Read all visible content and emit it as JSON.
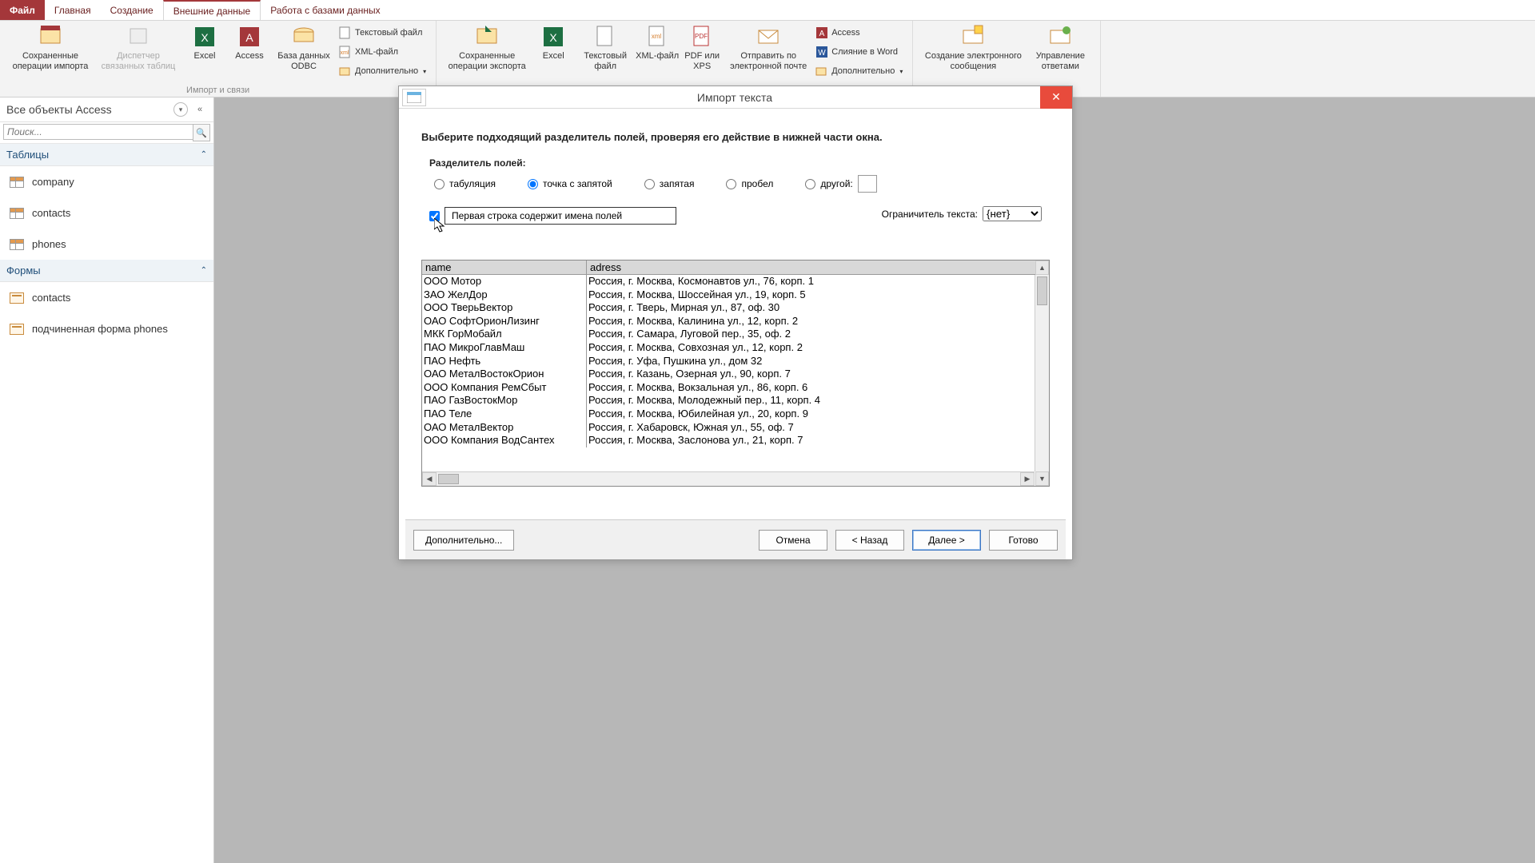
{
  "tabs": {
    "file": "Файл",
    "home": "Главная",
    "create": "Создание",
    "external": "Внешние данные",
    "db": "Работа с базами данных"
  },
  "ribbon": {
    "saved_import": "Сохраненные операции импорта",
    "linked_mgr": "Диспетчер связанных таблиц",
    "excel": "Excel",
    "access": "Access",
    "odbc": "База данных ODBC",
    "textfile": "Текстовый файл",
    "xmlfile": "XML-файл",
    "more": "Дополнительно",
    "group1": "Импорт и связи",
    "saved_export": "Сохраненные операции экспорта",
    "excel2": "Excel",
    "textfile2": "Текстовый файл",
    "xmlfile2": "XML-файл",
    "pdf": "PDF или XPS",
    "email": "Отправить по электронной почте",
    "access2": "Access",
    "word": "Слияние в Word",
    "more2": "Дополнительно",
    "emailmsg": "Создание электронного сообщения",
    "replies": "Управление ответами"
  },
  "nav": {
    "title": "Все объекты Access",
    "search_ph": "Поиск...",
    "group_tables": "Таблицы",
    "group_forms": "Формы",
    "tables": [
      "company",
      "contacts",
      "phones"
    ],
    "forms": [
      "contacts",
      "подчиненная форма phones"
    ]
  },
  "dialog": {
    "title": "Импорт текста",
    "instruction": "Выберите подходящий разделитель полей, проверяя его действие в нижней части окна.",
    "delimiter_label": "Разделитель полей:",
    "radios": {
      "tab": "табуляция",
      "semicolon": "точка с запятой",
      "comma": "запятая",
      "space": "пробел",
      "other": "другой:"
    },
    "selected": "semicolon",
    "firstrow_label": "Первая строка содержит имена полей",
    "firstrow_checked": true,
    "qualifier_label": "Ограничитель текста:",
    "qualifier_value": "{нет}",
    "columns": [
      "name",
      "adress"
    ],
    "rows": [
      [
        "ООО Мотор",
        "Россия, г. Москва, Космонавтов ул., 76, корп. 1"
      ],
      [
        "ЗАО ЖелДор",
        "Россия, г. Москва, Шоссейная ул., 19, корп. 5"
      ],
      [
        "ООО ТверьВектор",
        "Россия, г. Тверь, Мирная ул., 87, оф. 30"
      ],
      [
        "ОАО СофтОрионЛизинг",
        "Россия, г. Москва, Калинина ул., 12, корп. 2"
      ],
      [
        "МКК ГорМобайл",
        "Россия, г. Самара, Луговой пер., 35, оф. 2"
      ],
      [
        "ПАО МикроГлавМаш",
        "Россия, г. Москва, Совхозная ул., 12, корп. 2"
      ],
      [
        "ПАО Нефть",
        "Россия, г. Уфа, Пушкина ул., дом 32"
      ],
      [
        "ОАО МеталВостокОрион",
        "Россия, г. Казань, Озерная ул., 90, корп. 7"
      ],
      [
        "ООО Компания РемСбыт",
        "Россия, г. Москва, Вокзальная ул., 86, корп. 6"
      ],
      [
        "ПАО ГазВостокМор",
        "Россия, г. Москва, Молодежный пер., 11, корп. 4"
      ],
      [
        "ПАО Теле",
        "Россия, г. Москва, Юбилейная ул., 20, корп. 9"
      ],
      [
        "ОАО МеталВектор",
        "Россия, г. Хабаровск, Южная ул., 55, оф. 7"
      ],
      [
        "ООО Компания ВодСантех",
        "Россия, г. Москва, Заслонова ул., 21, корп. 7"
      ]
    ],
    "btn_more": "Дополнительно...",
    "btn_cancel": "Отмена",
    "btn_back": "< Назад",
    "btn_next": "Далее >",
    "btn_finish": "Готово"
  }
}
